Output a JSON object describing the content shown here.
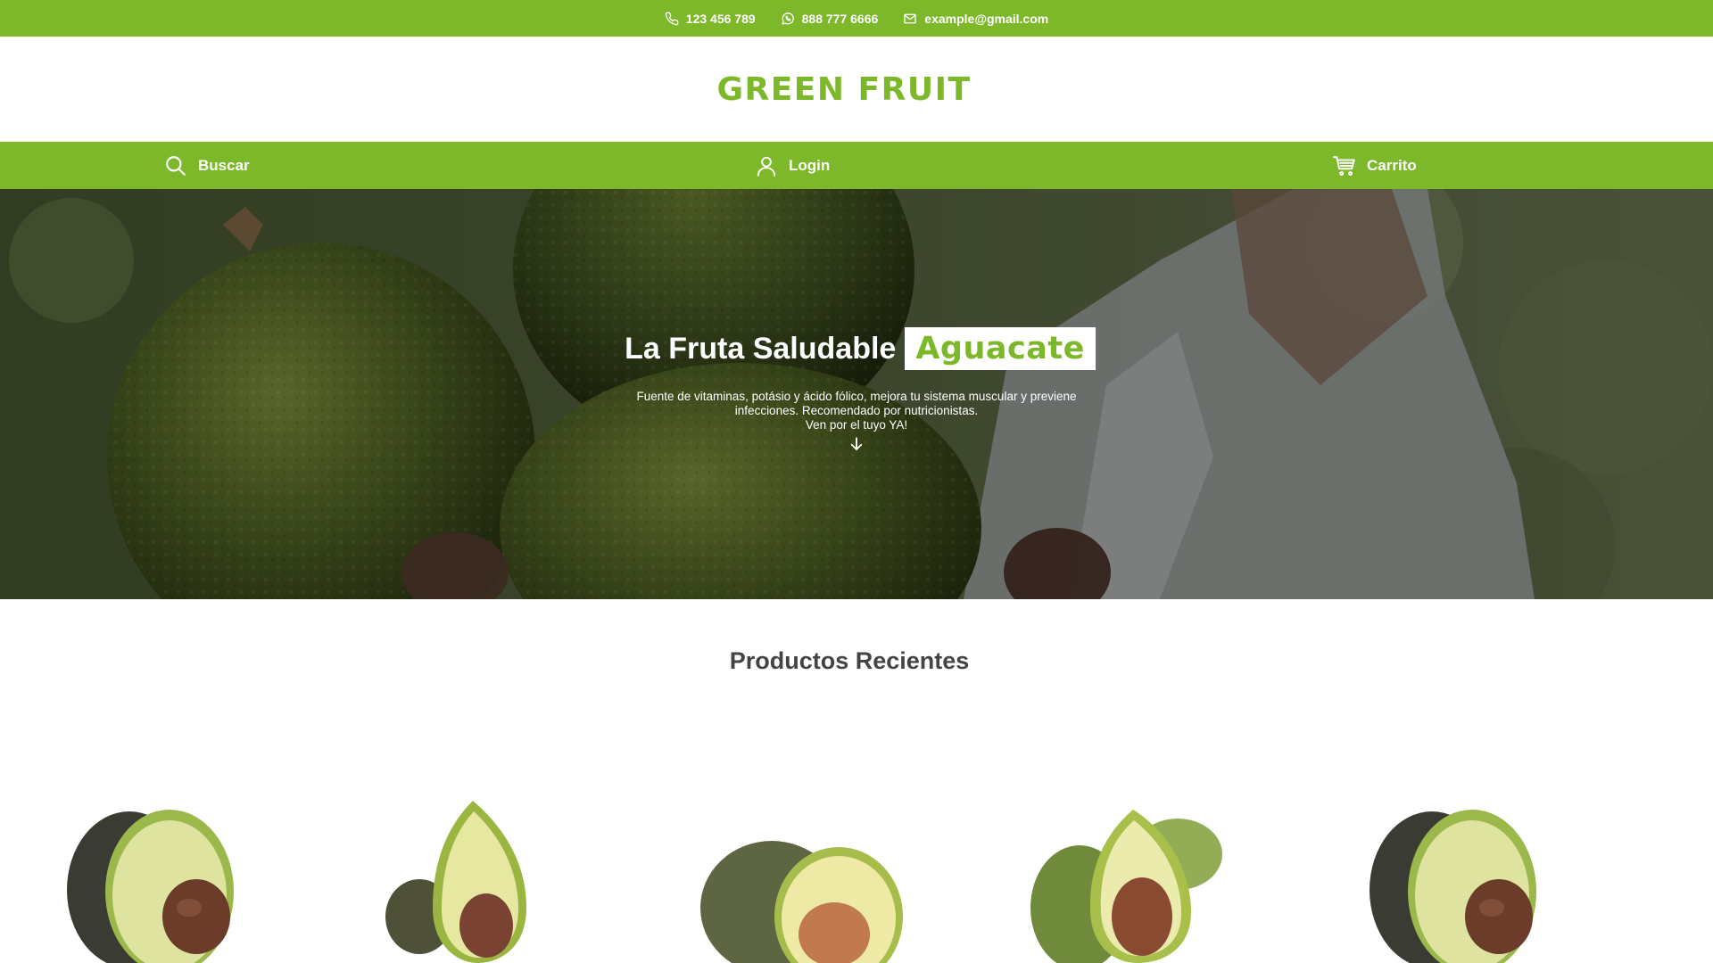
{
  "topbar": {
    "phone": "123 456 789",
    "whatsapp": "888 777 6666",
    "email": "example@gmail.com"
  },
  "brand": {
    "name": "GREEN FRUIT"
  },
  "nav": {
    "search_label": "Buscar",
    "login_label": "Login",
    "cart_label": "Carrito"
  },
  "hero": {
    "title_prefix": "La Fruta Saludable",
    "title_highlight": "Aguacate",
    "description_line1": "Fuente de vitaminas, potásio y ácido fólico, mejora tu sistema muscular y previene infecciones. Recomendado por nutricionistas.",
    "description_line2": "Ven por el tuyo YA!"
  },
  "products_section": {
    "title": "Productos Recientes"
  },
  "icons": {
    "phone": "phone-icon",
    "whatsapp": "whatsapp-icon",
    "email": "mail-icon",
    "search": "search-icon",
    "login": "user-icon",
    "cart": "cart-icon",
    "arrow": "arrow-down-icon"
  },
  "colors": {
    "brand_green": "#7db82a",
    "text_dark": "#444444",
    "white": "#ffffff"
  }
}
